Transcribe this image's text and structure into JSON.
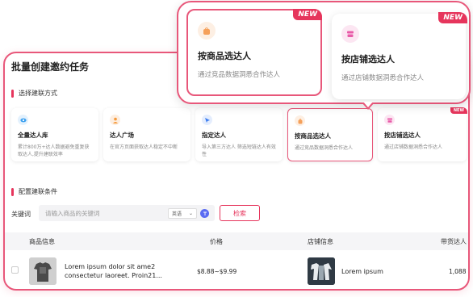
{
  "page": {
    "title": "批量创建邀约任务",
    "section_method": "选择建联方式",
    "section_conditions": "配置建联条件"
  },
  "methods": [
    {
      "title": "全量达人库",
      "desc": "累计800万+达人数据避免重复获取达人,提升建联效率",
      "icon": "eye-icon",
      "color": "#3aa0f0"
    },
    {
      "title": "达人广场",
      "desc": "在官方页面获取达人稳定不中断",
      "icon": "person-icon",
      "color": "#f59a3c"
    },
    {
      "title": "指定达人",
      "desc": "导入第三方达人 筛选短链达人有效性",
      "icon": "pin-icon",
      "color": "#3a7bf0"
    },
    {
      "title": "按商品选达人",
      "desc": "通过竞品数据洞悉合作达人",
      "icon": "bag-icon",
      "color": "#f5a05a"
    },
    {
      "title": "按店铺选达人",
      "desc": "通过店铺数据洞悉合作达人",
      "icon": "store-icon",
      "color": "#e85aa8"
    }
  ],
  "badge_new": "NEW",
  "search": {
    "label": "关键词",
    "placeholder": "请输入商品的关键词",
    "select_value": "英语",
    "button": "检索"
  },
  "table": {
    "headers": [
      "商品信息",
      "价格",
      "店铺信息",
      "带货达人"
    ],
    "rows": [
      {
        "product": "Lorem ipsum dolor sit ame2 consectetur laoreet. Proin21...",
        "price": "$8.88~$9.99",
        "shop": "Lorem ipsum",
        "count": "1,088"
      }
    ]
  },
  "zoom": {
    "card1": {
      "title": "按商品选达人",
      "desc": "通过竞品数据洞悉合作达人"
    },
    "card2": {
      "title": "按店铺选达人",
      "desc": "通过店铺数据洞悉合作达人"
    }
  }
}
